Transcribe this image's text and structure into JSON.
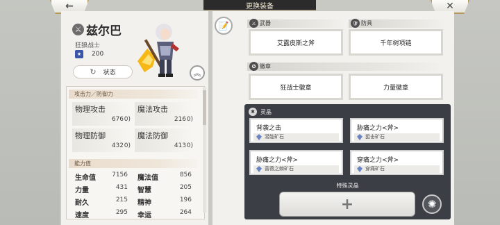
{
  "header": {
    "back_label": "←",
    "title": "更换装备",
    "close_label": "✕"
  },
  "character": {
    "name": "兹尔巴",
    "class": "狂狼战士",
    "level_value": "200",
    "status_label": "状态",
    "name_icon": "shield-crest-icon"
  },
  "stats": {
    "atk_def_header": "攻击力／防御力",
    "cells": [
      {
        "label": "物理攻击",
        "value": "676",
        "bonus": "0)"
      },
      {
        "label": "魔法攻击",
        "value": "216",
        "bonus": "0)"
      },
      {
        "label": "物理防御",
        "value": "432",
        "bonus": "0)"
      },
      {
        "label": "魔法防御",
        "value": "413",
        "bonus": "0)"
      }
    ],
    "ability_header": "能力值",
    "abilities": [
      {
        "k1": "生命值",
        "v1": "7156",
        "k2": "魔法值",
        "v2": "856"
      },
      {
        "k1": "力量",
        "v1": "431",
        "k2": "智慧",
        "v2": "205"
      },
      {
        "k1": "耐久",
        "v1": "215",
        "k2": "精神",
        "v2": "196"
      },
      {
        "k1": "速度",
        "v1": "295",
        "k2": "幸运",
        "v2": "264"
      }
    ]
  },
  "equipment": {
    "weapon_header": "武器",
    "weapon": "艾露皮斯之斧",
    "armor_header": "防具",
    "armor": "千年树项链",
    "emblem_header": "徽章",
    "emblem1": "狂战士徽章",
    "emblem2": "力量徽章"
  },
  "crystals": {
    "header": "灵晶",
    "slots": [
      {
        "title": "背袭之击",
        "ore": "潜能矿石"
      },
      {
        "title": "胁痛之力<斧>",
        "ore": "狙击矿石"
      },
      {
        "title": "胁痛之力<斧>",
        "ore": "蔷薇之棘矿石"
      },
      {
        "title": "穿痛之力<斧>",
        "ore": "穿痛矿石"
      }
    ],
    "special_label": "特殊灵晶",
    "add_label": "+"
  },
  "colors": {
    "panel_bg": "#f2f1ed",
    "dark_panel": "#3c3e46",
    "gold_border": "#b59a5c"
  }
}
